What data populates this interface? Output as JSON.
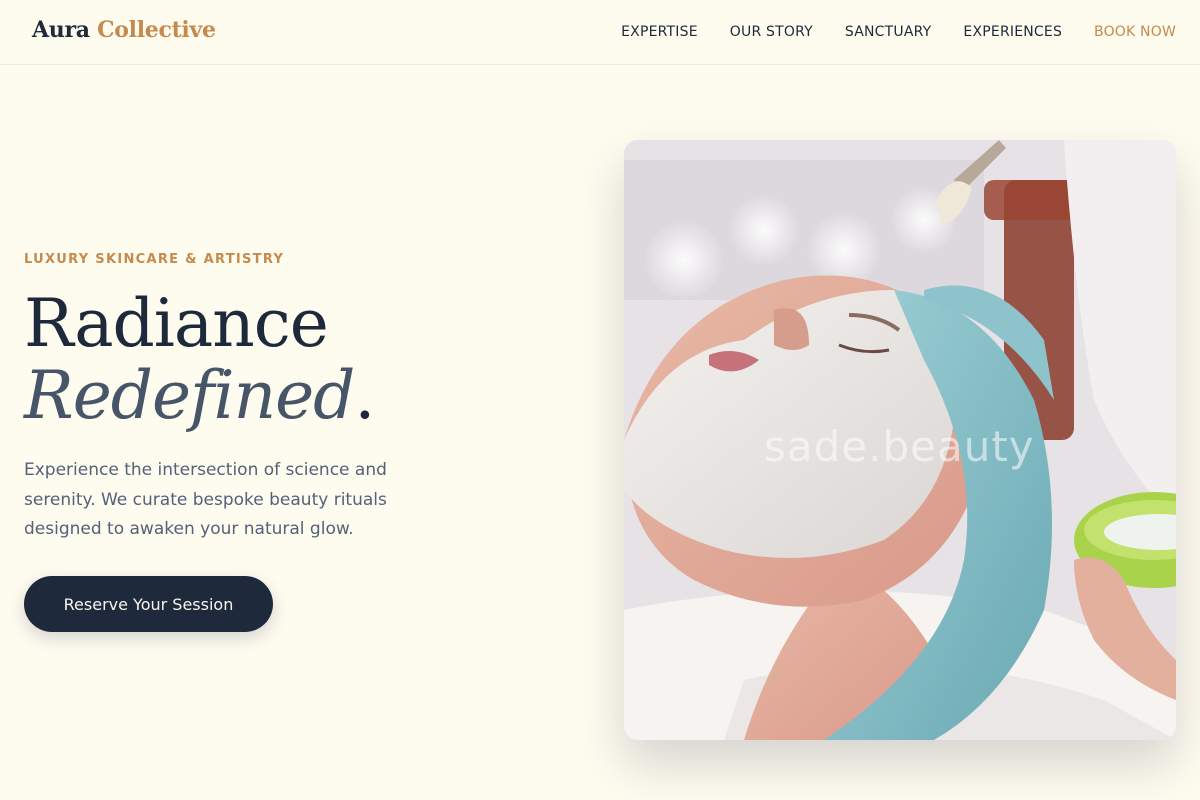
{
  "brand": {
    "name_primary": "Aura",
    "name_accent": "Collective",
    "accent_color": "#c68a4c",
    "primary_color": "#1e293b"
  },
  "nav": {
    "items": [
      {
        "label": "EXPERTISE"
      },
      {
        "label": "OUR STORY"
      },
      {
        "label": "SANCTUARY"
      },
      {
        "label": "EXPERIENCES"
      }
    ],
    "cta_label": "BOOK NOW"
  },
  "hero": {
    "eyebrow": "LUXURY SKINCARE & ARTISTRY",
    "headline_line_1": "Radiance",
    "headline_line_2": "Redefined",
    "headline_period": ".",
    "lede": "Experience the intersection of science and serenity. We curate bespoke beauty rituals designed to awaken your natural glow.",
    "cta_label": "Reserve Your Session"
  },
  "hero_image": {
    "watermark": "sade.beauty",
    "subject": "facial-treatment-photo"
  }
}
